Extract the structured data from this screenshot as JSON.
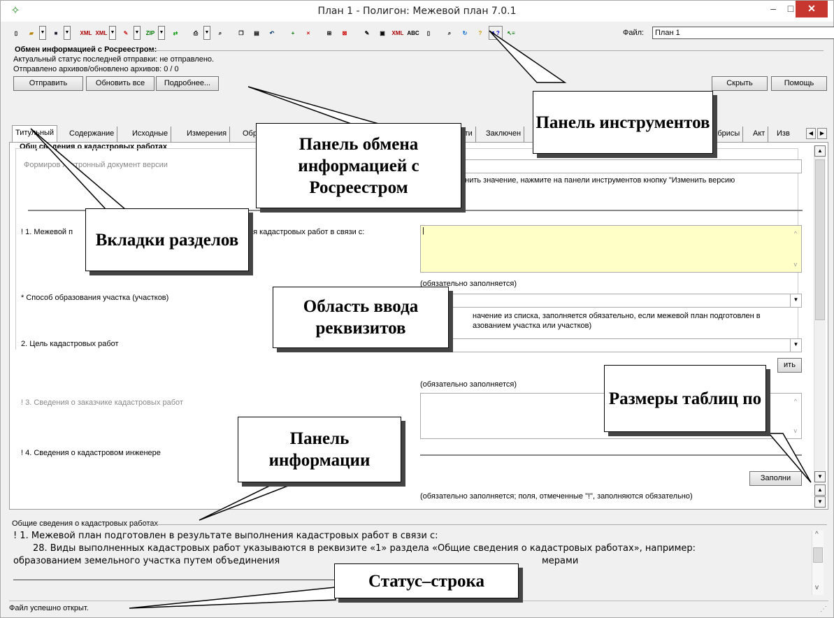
{
  "window": {
    "title": "План 1 - Полигон: Межевой план 7.0.1",
    "minimize": "–",
    "maximize": "□",
    "close": "✕"
  },
  "toolbar": {
    "file_label": "Файл:",
    "file_value": "План 1"
  },
  "exchange": {
    "title": "Обмен информацией с Росреестром:",
    "status_line": "Актуальный статус последней отправки: не отправлено.",
    "archives_line": "Отправлено архивов/обновлено архивов: 0 / 0",
    "send": "Отправить",
    "refresh_all": "Обновить все",
    "details": "Подробнее...",
    "hide": "Скрыть",
    "help": "Помощь"
  },
  "tabs": [
    {
      "label": "Титульный"
    },
    {
      "label": "Содержание"
    },
    {
      "label": "Исходные"
    },
    {
      "label": "Измерения"
    },
    {
      "label": "Обра"
    },
    {
      "label": "асти"
    },
    {
      "label": "Заключен"
    },
    {
      "label": "Абрисы"
    },
    {
      "label": "Акт"
    },
    {
      "label": "Изв"
    }
  ],
  "form": {
    "group_title": "Общ   сведения о кадастровых работах",
    "version_label": "Формиров   лектронный документ версии",
    "version_hint_1": "енить значение, нажмите на панели инструментов кнопку \"Изменить версию",
    "version_hint_2": "\")",
    "row1_label_start": "! 1. Межевой п",
    "row1_label_end": "ия кадастровых работ в связи с:",
    "row1_field_value": "|",
    "row1_note": "(обязательно заполняется)",
    "method_label": "* Способ образования участка (участков)",
    "method_hint_1": "начение из списка, заполняется обязательно, если межевой план подготовлен в",
    "method_hint_2": "азованием участка или участков)",
    "purpose_label": "2. Цель кадастровых работ",
    "purpose_button": "ить",
    "purpose_note": "(обязательно заполняется)",
    "customer_label": "! 3. Сведения о заказчике кадастровых работ",
    "engineer_label": "! 4. Сведения о кадастровом инженере",
    "fill_button": "Заполни",
    "engineer_note": "(обязательно заполняется; поля, отмеченные \"!\", заполняются обязательно)"
  },
  "info": {
    "title": "Общие сведения о кадастровых работах",
    "line1": "! 1. Межевой план подготовлен в результате выполнения кадастровых работ в связи с:",
    "line2": "28. Виды выполненных кадастровых работ указываются в реквизите «1» раздела «Общие сведения о кадастровых работах», например:",
    "line3a": "образованием земельного участка путем объединения",
    "line3b": "мерами"
  },
  "status": {
    "text": "Файл успешно открыт."
  },
  "callouts": {
    "toolbar_panel": "Панель инструментов",
    "exchange_panel": "Панель обмена информацией с Росреестром",
    "section_tabs": "Вкладки разделов",
    "input_area": "Область ввода реквизитов",
    "table_sizes": "Размеры таблиц по",
    "info_panel": "Панель информации",
    "status_bar": "Статус–строка"
  }
}
